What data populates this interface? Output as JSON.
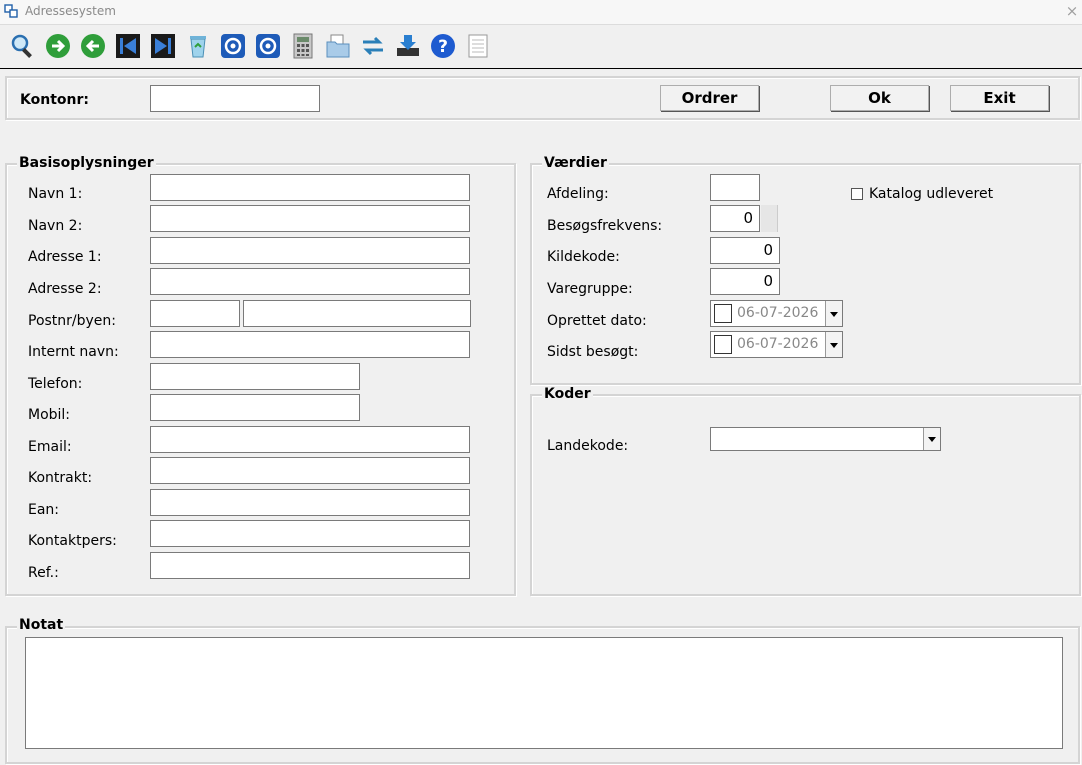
{
  "window": {
    "title": "Adressesystem",
    "close_glyph": "×"
  },
  "toolbar": {
    "icons": [
      "search-icon",
      "next-record-icon",
      "previous-record-icon",
      "first-record-icon",
      "last-record-icon",
      "recycle-icon",
      "target-icon",
      "target-2-icon",
      "calculator-icon",
      "open-folder-icon",
      "transfer-icon",
      "download-icon",
      "help-icon",
      "notepad-icon"
    ]
  },
  "header": {
    "kontonr_label": "Kontonr:",
    "kontonr_value": "",
    "ordrer_label": "Ordrer",
    "ok_label": "Ok",
    "exit_label": "Exit"
  },
  "basis": {
    "title": "Basisoplysninger",
    "navn1": "Navn 1:",
    "navn2": "Navn 2:",
    "adresse1": "Adresse 1:",
    "adresse2": "Adresse 2:",
    "postnr": "Postnr/byen:",
    "internt": "Internt navn:",
    "telefon": "Telefon:",
    "mobil": "Mobil:",
    "email": "Email:",
    "kontrakt": "Kontrakt:",
    "ean": "Ean:",
    "kontaktpers": "Kontaktpers:",
    "ref": "Ref.:"
  },
  "vaerdier": {
    "title": "Værdier",
    "afdeling": "Afdeling:",
    "besoeg": "Besøgsfrekvens:",
    "kildekode": "Kildekode:",
    "varegruppe": "Varegruppe:",
    "oprettet": "Oprettet dato:",
    "sidst": "Sidst besøgt:",
    "besoeg_value": "0",
    "kildekode_value": "0",
    "varegruppe_value": "0",
    "oprettet_value": "06-07-2026",
    "sidst_value": "06-07-2026",
    "katalog": "Katalog udleveret"
  },
  "koder": {
    "title": "Koder",
    "landekode": "Landekode:",
    "landekode_value": ""
  },
  "notat": {
    "title": "Notat",
    "value": ""
  }
}
